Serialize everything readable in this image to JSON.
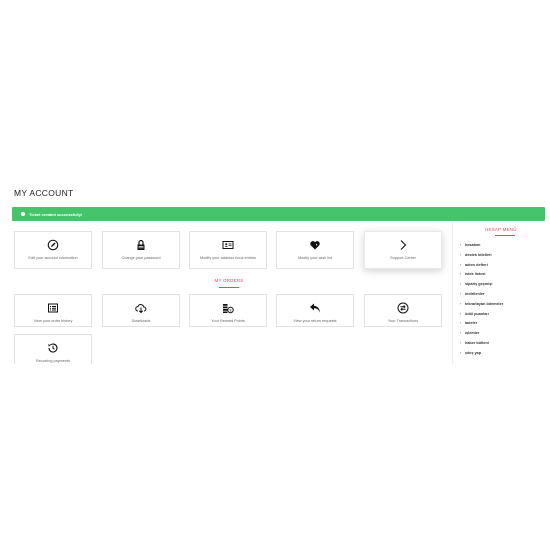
{
  "page": {
    "title": "MY ACCOUNT"
  },
  "alert": {
    "message": "Ticket created successfully!"
  },
  "account_cards": [
    {
      "label": "Edit your account information",
      "icon": "pencil-circle-icon"
    },
    {
      "label": "Change your password",
      "icon": "lock-icon"
    },
    {
      "label": "Modify your address book entries",
      "icon": "address-card-icon"
    },
    {
      "label": "Modify your wish list",
      "icon": "heart-icon"
    },
    {
      "label": "Support Center",
      "icon": "chevron-right-icon"
    }
  ],
  "orders": {
    "heading": "MY ORDERS",
    "cards": [
      {
        "label": "View your order history",
        "icon": "list-icon"
      },
      {
        "label": "Downloads",
        "icon": "cloud-download-icon"
      },
      {
        "label": "Your Reward Points",
        "icon": "money-icon"
      },
      {
        "label": "View your return requests",
        "icon": "reply-icon"
      },
      {
        "label": "Your Transactions",
        "icon": "exchange-icon"
      },
      {
        "label": "Recurring payments",
        "icon": "history-icon"
      }
    ]
  },
  "sidebar": {
    "heading": "HESAP MENÜ",
    "items": [
      "hesabım",
      "destek biletleri",
      "adres defteri",
      "istek listesi",
      "sipariş geçmişi",
      "indirilenler",
      "tekrarlayan ödemeler",
      "ödül puanları",
      "iadeler",
      "işlemler",
      "haber bülteni",
      "çıkış yap"
    ]
  },
  "colors": {
    "accent": "#e84a5f",
    "success": "#45c46b"
  }
}
